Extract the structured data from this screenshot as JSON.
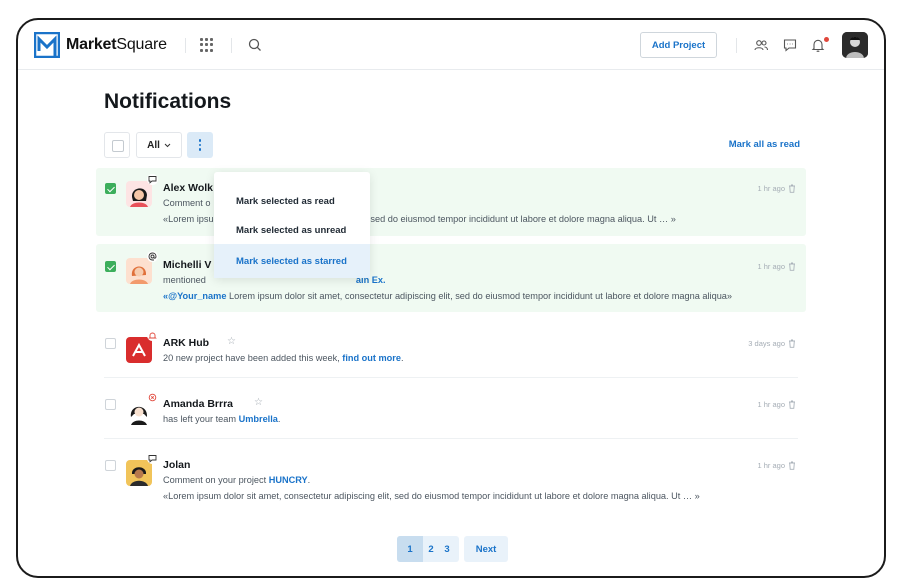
{
  "app": {
    "brand_bold": "Market",
    "brand_light": "Square"
  },
  "header": {
    "add_project_label": "Add Project"
  },
  "page": {
    "title": "Notifications"
  },
  "toolbar": {
    "filter_value": "All",
    "mark_all_label": "Mark all as read"
  },
  "menu": {
    "items": [
      {
        "label": "Mark selected as read"
      },
      {
        "label": "Mark selected as unread"
      },
      {
        "label": "Mark selected as starred"
      }
    ]
  },
  "notifications": [
    {
      "name": "Alex Wolk",
      "line1": "Comment o",
      "line2": "«Lorem ipsu",
      "line2_rest": "scing elit, sed do eiusmod tempor incididunt ut labore et dolore magna aliqua. Ut  … »",
      "time": "1 hr ago",
      "selected": true,
      "badge_icon": "comment-icon"
    },
    {
      "name": "Michelli V",
      "line1": "mentioned",
      "line1_link": "ain Ex.",
      "mention": "«@Your_name",
      "line2_rest": " Lorem ipsum dolor sit amet, consectetur adipiscing elit, sed do eiusmod tempor incididunt ut labore et dolore magna aliqua»",
      "time": "1 hr ago",
      "selected": true,
      "badge_icon": "at-icon"
    },
    {
      "name": "ARK Hub",
      "line1": "20 new project have been added this week, ",
      "line1_link": "find out more",
      "line1_end": ".",
      "time": "3 days ago",
      "selected": false,
      "badge_icon": "bell-icon"
    },
    {
      "name": "Amanda Brrra",
      "line1": "has left your team ",
      "line1_link": "Umbrella",
      "line1_end": ".",
      "time": "1 hr ago",
      "selected": false,
      "badge_icon": "close-circle-icon"
    },
    {
      "name": "Jolan",
      "line1": "Comment on your project ",
      "line1_link": "HUNCRY",
      "line1_end": ".",
      "line2": "«Lorem ipsum dolor sit amet, consectetur adipiscing elit, sed do eiusmod tempor incididunt ut labore et dolore magna aliqua. Ut  … »",
      "time": "1 hr ago",
      "selected": false,
      "badge_icon": "comment-icon"
    }
  ],
  "pagination": {
    "pages": [
      "1",
      "2",
      "3"
    ],
    "current": "1",
    "next_label": "Next"
  },
  "colors": {
    "accent": "#1a73c9",
    "selected_row": "#f0faf2",
    "check_green": "#3cae5c",
    "alert_red": "#e0473b"
  }
}
